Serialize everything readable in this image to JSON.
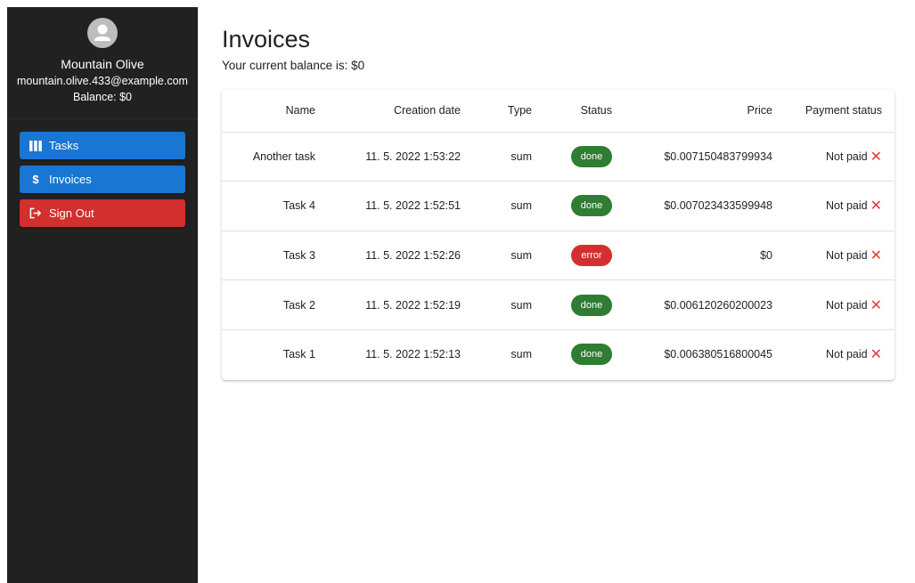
{
  "sidebar": {
    "user": {
      "name": "Mountain Olive",
      "email": "mountain.olive.433@example.com",
      "balance": "Balance: $0"
    },
    "nav": [
      {
        "label": "Tasks",
        "icon": "tasks-icon",
        "color": "#1976d2"
      },
      {
        "label": "Invoices",
        "icon": "dollar-icon",
        "color": "#1976d2"
      },
      {
        "label": "Sign Out",
        "icon": "sign-out-icon",
        "color": "#d32f2f"
      }
    ]
  },
  "main": {
    "title": "Invoices",
    "balance_text": "Your current balance is: $0",
    "table": {
      "headers": [
        "Name",
        "Creation date",
        "Type",
        "Status",
        "Price",
        "Payment status"
      ],
      "rows": [
        {
          "name": "Another task",
          "date": "11. 5. 2022 1:53:22",
          "type": "sum",
          "status": "done",
          "price": "$0.007150483799934",
          "payment": "Not paid"
        },
        {
          "name": "Task 4",
          "date": "11. 5. 2022 1:52:51",
          "type": "sum",
          "status": "done",
          "price": "$0.007023433599948",
          "payment": "Not paid"
        },
        {
          "name": "Task 3",
          "date": "11. 5. 2022 1:52:26",
          "type": "sum",
          "status": "error",
          "price": "$0",
          "payment": "Not paid"
        },
        {
          "name": "Task 2",
          "date": "11. 5. 2022 1:52:19",
          "type": "sum",
          "status": "done",
          "price": "$0.006120260200023",
          "payment": "Not paid"
        },
        {
          "name": "Task 1",
          "date": "11. 5. 2022 1:52:13",
          "type": "sum",
          "status": "done",
          "price": "$0.006380516800045",
          "payment": "Not paid"
        }
      ]
    }
  },
  "colors": {
    "sidebar_bg": "#212121",
    "primary": "#1976d2",
    "danger": "#d32f2f",
    "success": "#2e7d32",
    "not_paid_icon": "#e53935"
  }
}
